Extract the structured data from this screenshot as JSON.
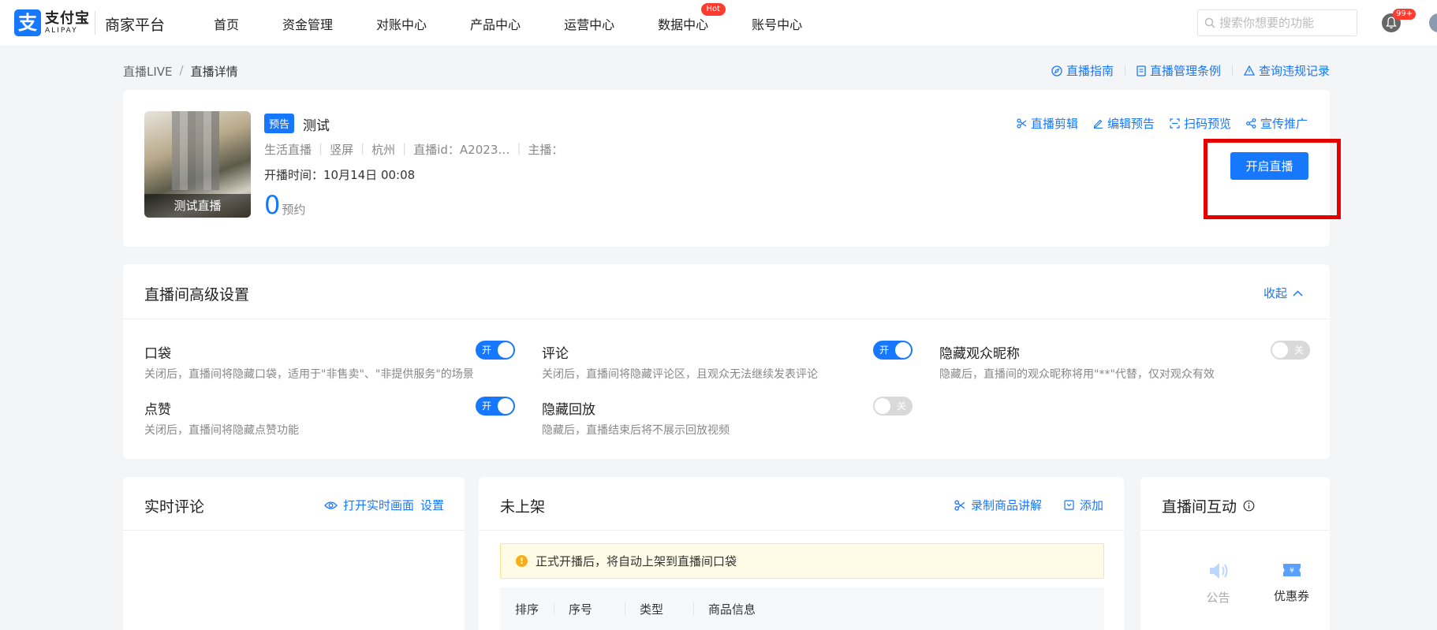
{
  "header": {
    "logo_cn": "支付宝",
    "logo_en": "ALIPAY",
    "platform": "商家平台",
    "nav": [
      {
        "label": "首页"
      },
      {
        "label": "资金管理"
      },
      {
        "label": "对账中心"
      },
      {
        "label": "产品中心"
      },
      {
        "label": "运营中心"
      },
      {
        "label": "数据中心",
        "badge": "Hot"
      },
      {
        "label": "账号中心"
      }
    ],
    "search_placeholder": "搜索你想要的功能",
    "notification_count": "99+"
  },
  "breadcrumb": {
    "parent": "直播LIVE",
    "separator": "/",
    "current": "直播详情"
  },
  "top_links": [
    "直播指南",
    "直播管理条例",
    "查询违规记录"
  ],
  "live": {
    "cover_label": "测试直播",
    "tag": "预告",
    "title": "测试",
    "meta": [
      "生活直播",
      "竖屏",
      "杭州",
      "直播id：A2023…",
      "主播："
    ],
    "start_time": "开播时间：10月14日 00:08",
    "reserve_count": "0",
    "reserve_label": "预约",
    "actions": [
      "直播剪辑",
      "编辑预告",
      "扫码预览",
      "宣传推广"
    ],
    "start_button": "开启直播"
  },
  "settings": {
    "title": "直播间高级设置",
    "collapse_label": "收起",
    "items": [
      {
        "name": "口袋",
        "desc": "关闭后，直播间将隐藏口袋，适用于\"非售卖\"、\"非提供服务\"的场景",
        "state": "开",
        "on": true
      },
      {
        "name": "评论",
        "desc": "关闭后，直播间将隐藏评论区，且观众无法继续发表评论",
        "state": "开",
        "on": true
      },
      {
        "name": "隐藏观众昵称",
        "desc": "隐藏后，直播间的观众昵称将用\"**\"代替，仅对观众有效",
        "state": "关",
        "on": false
      },
      {
        "name": "点赞",
        "desc": "关闭后，直播间将隐藏点赞功能",
        "state": "开",
        "on": true
      },
      {
        "name": "隐藏回放",
        "desc": "隐藏后，直播结束后将不展示回放视频",
        "state": "关",
        "on": false
      }
    ]
  },
  "comments": {
    "title": "实时评论",
    "open_label": "打开实时画面",
    "settings_label": "设置"
  },
  "goods": {
    "title": "未上架",
    "record_label": "录制商品讲解",
    "add_label": "添加",
    "notice": "正式开播后，将自动上架到直播间口袋",
    "columns": [
      "排序",
      "序号",
      "类型",
      "商品信息"
    ]
  },
  "interaction": {
    "title": "直播间互动",
    "items": [
      "公告",
      "优惠券"
    ]
  },
  "colors": {
    "primary": "#1677ff",
    "highlight": "#e60000",
    "hot": "#ff3b30",
    "warning": "#faad14"
  }
}
